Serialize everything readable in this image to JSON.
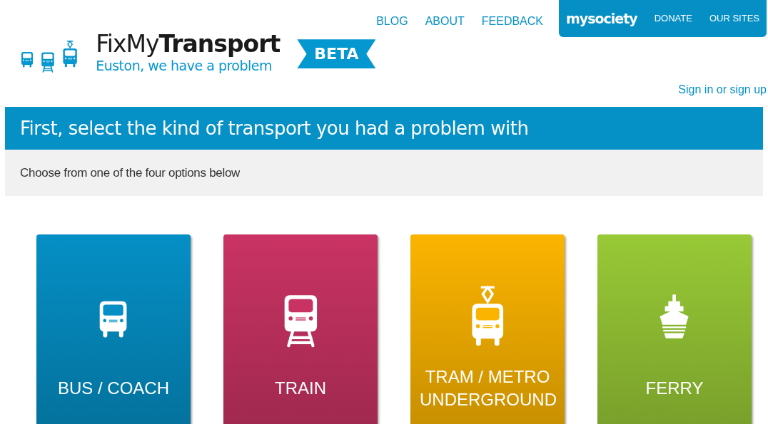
{
  "logo": {
    "name_light": "FixMy",
    "name_bold": "Transport",
    "tagline": "Euston, we have a problem",
    "badge": "BETA"
  },
  "nav": [
    "BLOG",
    "ABOUT",
    "FEEDBACK"
  ],
  "network_bar": {
    "brand": "mysociety",
    "links": [
      "DONATE",
      "OUR SITES"
    ]
  },
  "account_link": "Sign in or sign up",
  "heading": "First, select the kind of transport you had a problem with",
  "instructions": "Choose from one of the four options below",
  "transport_options": [
    {
      "kind": "bus",
      "label": "BUS / COACH",
      "color": "#058fc5"
    },
    {
      "kind": "train",
      "label": "TRAIN",
      "color": "#c93363"
    },
    {
      "kind": "tram",
      "label": "TRAM / METRO UNDERGROUND",
      "color": "#fbb400"
    },
    {
      "kind": "ferry",
      "label": "FERRY",
      "color": "#98c936"
    }
  ]
}
